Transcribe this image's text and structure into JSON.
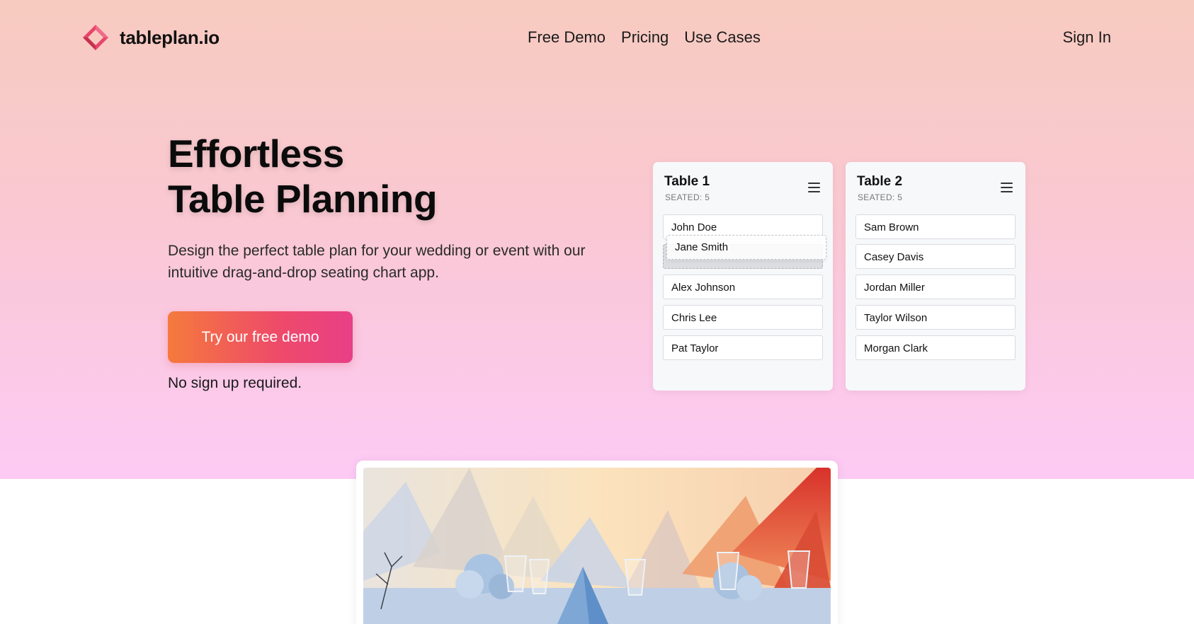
{
  "brand": {
    "name": "tableplan.io",
    "logo_icon": "diamond-logo-icon"
  },
  "nav": {
    "links": [
      "Free Demo",
      "Pricing",
      "Use Cases"
    ],
    "sign_in": "Sign In"
  },
  "hero": {
    "headline_line1": "Effortless",
    "headline_line2": "Table Planning",
    "subtext": "Design the perfect table plan for your wedding or event with our intuitive drag-and-drop seating chart app.",
    "cta_label": "Try our free demo",
    "cta_note": "No sign up required."
  },
  "tables": [
    {
      "title": "Table 1",
      "seated": "SEATED: 5",
      "guests": [
        "John Doe",
        "Alex Johnson",
        "Chris Lee",
        "Pat Taylor"
      ],
      "dragging_guest": "Jane Smith"
    },
    {
      "title": "Table 2",
      "seated": "SEATED: 5",
      "guests": [
        "Sam Brown",
        "Casey Davis",
        "Jordan Miller",
        "Taylor Wilson",
        "Morgan Clark"
      ]
    }
  ],
  "colors": {
    "hero_top": "#f8cbc0",
    "hero_bottom": "#fdcaf5",
    "cta_start": "#f57a3c",
    "cta_end": "#e83f86",
    "logo_accent": "#e8456b"
  }
}
